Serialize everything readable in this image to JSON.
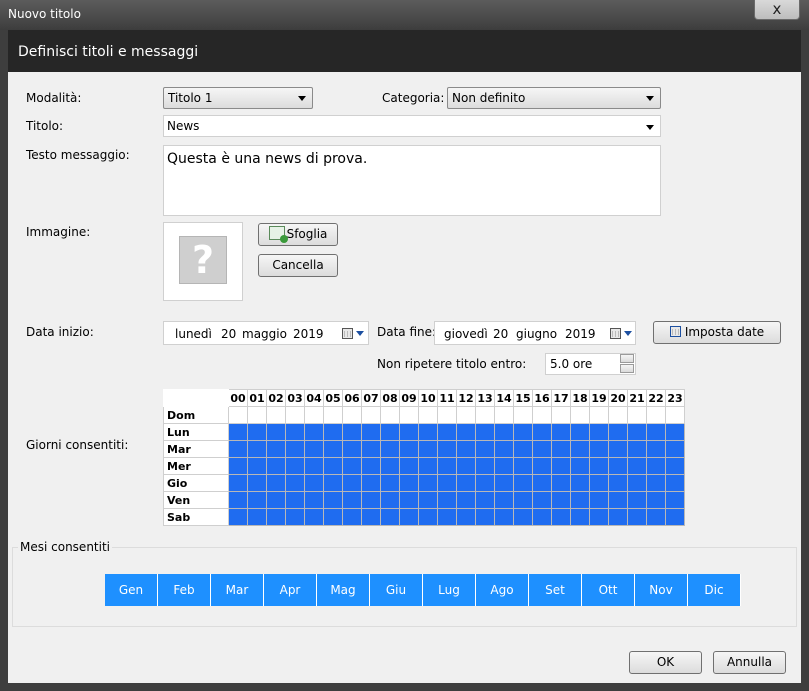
{
  "window": {
    "title": "Nuovo titolo",
    "close_glyph": "x"
  },
  "header": {
    "title": "Definisci titoli e messaggi"
  },
  "form": {
    "modalita_label": "Modalità:",
    "modalita_value": "Titolo 1",
    "categoria_label": "Categoria:",
    "categoria_value": "Non definito",
    "titolo_label": "Titolo:",
    "titolo_value": "News",
    "testo_label": "Testo messaggio:",
    "testo_value": "Questa è una news di prova.",
    "immagine_label": "Immagine:",
    "image_placeholder_glyph": "?",
    "sfoglia_label": "Sfoglia",
    "cancella_label": "Cancella",
    "data_inizio_label": "Data inizio:",
    "data_inizio": {
      "weekday": "lunedì",
      "day": "20",
      "month": "maggio",
      "year": "2019"
    },
    "data_fine_label": "Data fine:",
    "data_fine": {
      "weekday": "giovedì",
      "day": "20",
      "month": "giugno",
      "year": "2019"
    },
    "imposta_date_label": "Imposta date",
    "non_ripetere_label": "Non ripetere titolo entro:",
    "non_ripetere_value": "5.0 ore",
    "giorni_label": "Giorni consentiti:"
  },
  "schedule": {
    "hours": [
      "00",
      "01",
      "02",
      "03",
      "04",
      "05",
      "06",
      "07",
      "08",
      "09",
      "10",
      "11",
      "12",
      "13",
      "14",
      "15",
      "16",
      "17",
      "18",
      "19",
      "20",
      "21",
      "22",
      "23"
    ],
    "days": [
      {
        "name": "Dom",
        "enabled": false
      },
      {
        "name": "Lun",
        "enabled": true
      },
      {
        "name": "Mar",
        "enabled": true
      },
      {
        "name": "Mer",
        "enabled": true
      },
      {
        "name": "Gio",
        "enabled": true
      },
      {
        "name": "Ven",
        "enabled": true
      },
      {
        "name": "Sab",
        "enabled": true
      }
    ],
    "enabled_color": "#1f6cf0"
  },
  "months": {
    "title": "Mesi consentiti",
    "items": [
      "Gen",
      "Feb",
      "Mar",
      "Apr",
      "Mag",
      "Giu",
      "Lug",
      "Ago",
      "Set",
      "Ott",
      "Nov",
      "Dic"
    ],
    "color": "#1e90ff"
  },
  "footer": {
    "ok_label": "OK",
    "annulla_label": "Annulla"
  },
  "icons": [
    "close-icon",
    "dropdown-arrow-icon",
    "question-mark-icon",
    "add-image-icon",
    "calendar-icon",
    "spin-up-icon",
    "spin-down-icon"
  ]
}
